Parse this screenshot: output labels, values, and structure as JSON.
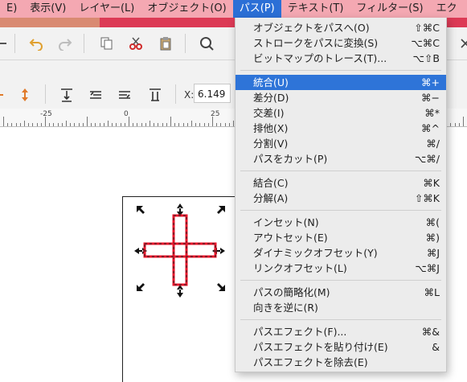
{
  "menubar": {
    "items": [
      {
        "label": "E)"
      },
      {
        "label": "表示(V)"
      },
      {
        "label": "レイヤー(L)"
      },
      {
        "label": "オブジェクト(O)"
      },
      {
        "label": "パス(P)"
      },
      {
        "label": "テキスト(T)"
      },
      {
        "label": "フィルター(S)"
      },
      {
        "label": "エク"
      }
    ],
    "active_index": 4
  },
  "toolbar": {
    "x_label": "X:",
    "x_value": "6.149"
  },
  "ruler": {
    "labels": [
      "-25",
      "0",
      "25"
    ]
  },
  "path_menu": {
    "groups": [
      [
        {
          "label": "オブジェクトをパスへ(O)",
          "shortcut": "⇧⌘C"
        },
        {
          "label": "ストロークをパスに変換(S)",
          "shortcut": "⌥⌘C"
        },
        {
          "label": "ビットマップのトレース(T)...",
          "shortcut": "⌥⇧B"
        }
      ],
      [
        {
          "label": "統合(U)",
          "shortcut": "⌘+",
          "highlighted": true
        },
        {
          "label": "差分(D)",
          "shortcut": "⌘−"
        },
        {
          "label": "交差(I)",
          "shortcut": "⌘*"
        },
        {
          "label": "排他(X)",
          "shortcut": "⌘^"
        },
        {
          "label": "分割(V)",
          "shortcut": "⌘/"
        },
        {
          "label": "パスをカット(P)",
          "shortcut": "⌥⌘/"
        }
      ],
      [
        {
          "label": "結合(C)",
          "shortcut": "⌘K"
        },
        {
          "label": "分解(A)",
          "shortcut": "⇧⌘K"
        }
      ],
      [
        {
          "label": "インセット(N)",
          "shortcut": "⌘("
        },
        {
          "label": "アウトセット(E)",
          "shortcut": "⌘)"
        },
        {
          "label": "ダイナミックオフセット(Y)",
          "shortcut": "⌘J"
        },
        {
          "label": "リンクオフセット(L)",
          "shortcut": "⌥⌘J"
        }
      ],
      [
        {
          "label": "パスの簡略化(M)",
          "shortcut": "⌘L"
        },
        {
          "label": "向きを逆に(R)",
          "shortcut": ""
        }
      ],
      [
        {
          "label": "パスエフェクト(F)...",
          "shortcut": "⌘&"
        },
        {
          "label": "パスエフェクトを貼り付け(E)",
          "shortcut": "&"
        },
        {
          "label": "パスエフェクトを除去(E)",
          "shortcut": ""
        }
      ]
    ]
  },
  "colors": {
    "menubar_bg": "#f4a8b2",
    "accent": "#dc3a55",
    "highlight": "#2e74d8",
    "shape_stroke": "#e8142a"
  }
}
